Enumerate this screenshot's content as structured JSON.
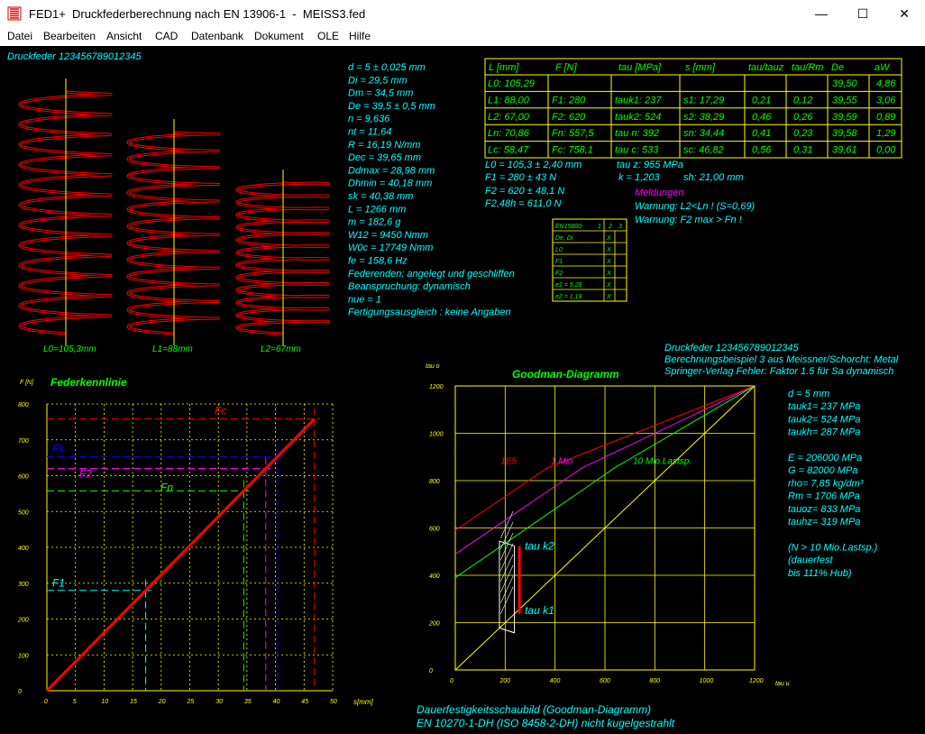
{
  "window": {
    "title": "FED1+  Druckfederberechnung nach EN 13906-1  -  MEISS3.fed",
    "minimize": "—",
    "maximize": "☐",
    "close": "✕"
  },
  "menu": [
    "Datei",
    "Bearbeiten",
    "Ansicht",
    "CAD",
    "Datenbank",
    "Dokument",
    "OLE",
    "Hilfe"
  ],
  "header": {
    "druckfeder": "Druckfeder  123456789012345"
  },
  "spring_labels": [
    "L0=105,3mm",
    "L1=88mm",
    "L2=67mm"
  ],
  "params": [
    "d = 5 ± 0,025 mm",
    "Di = 29,5 mm",
    "Dm = 34,5 mm",
    "De = 39,5 ± 0,5 mm",
    "n = 9,636",
    "nt = 11,64",
    "R = 16,19 N/mm",
    "Dec = 39,65 mm",
    "Ddmax = 28,98 mm",
    "Dhmin = 40,18 mm",
    "sk = 40,38 mm",
    "L = 1266 mm",
    "m = 182,6 g",
    "W12 = 9450 Nmm",
    "W0c = 17749 Nmm",
    "fe = 158,6 Hz",
    "Federenden: angelegt und geschliffen",
    "Beanspruchung: dynamisch",
    "nue = 1",
    "Fertigungsausgleich : keine Angaben"
  ],
  "table": {
    "headers": [
      "L [mm]",
      "F [N]",
      "tau [MPa]",
      "s [mm]",
      "tau/tauz",
      "tau/Rm",
      "De",
      "aW"
    ],
    "rows": [
      [
        "L0: 105,29",
        "",
        "",
        "",
        "",
        "",
        "39,50",
        "4,86"
      ],
      [
        "L1:  88,00",
        "F1: 280",
        "tauk1: 237",
        "s1:  17,29",
        "0,21",
        "0,12",
        "39,55",
        "3,06"
      ],
      [
        "L2:  67,00",
        "F2: 620",
        "tauk2: 524",
        "s2:  38,29",
        "0,46",
        "0,26",
        "39,59",
        "0,89"
      ],
      [
        "Ln:  70,86",
        "Fn: 557,5",
        "tau n: 392",
        "sn:  34,44",
        "0,41",
        "0,23",
        "39,58",
        "1,29"
      ],
      [
        "Lc:  58,47",
        "Fc: 758,1",
        "tau c: 533",
        "sc:  46,82",
        "0,56",
        "0,31",
        "39,61",
        "0,00"
      ]
    ]
  },
  "summary": {
    "left": [
      "L0 = 105,3 ± 2,40 mm",
      "F1 = 280 ± 43 N",
      "F2 = 620 ± 48,1 N",
      "F2,48h = 611,0 N"
    ],
    "tauz": "tau z: 955 MPa",
    "k": "k = 1,203",
    "sh": "sh:  21,00 mm"
  },
  "messages": {
    "title": "Meldungen",
    "lines": [
      "Warnung: L2<Ln ! (S=0,69)",
      "Warnung: F2 max > Fn !"
    ]
  },
  "en_table": {
    "header": [
      "EN15800-",
      "1",
      "2",
      "3"
    ],
    "rows": [
      [
        "De, Di",
        "X"
      ],
      [
        "L0",
        "X"
      ],
      [
        "F1",
        "X"
      ],
      [
        "F2",
        "X"
      ],
      [
        "e1 = 5,28",
        "X"
      ],
      [
        "e2 = 1,19",
        "X"
      ]
    ]
  },
  "chart_data": [
    {
      "type": "line",
      "title": "Federkennlinie",
      "ylabel": "F [N]",
      "xlabel": "s[mm]",
      "xlim": [
        0,
        50
      ],
      "ylim": [
        0,
        800
      ],
      "xticks": [
        "0",
        "5",
        "10",
        "15",
        "20",
        "25",
        "30",
        "35",
        "40",
        "45",
        "50"
      ],
      "yticks": [
        "0",
        "100",
        "200",
        "300",
        "400",
        "500",
        "600",
        "700",
        "800"
      ],
      "grid": true,
      "series": [
        {
          "name": "",
          "x": [
            0,
            46.82
          ],
          "y": [
            0,
            758.1
          ]
        }
      ],
      "markers": [
        {
          "name": "F1",
          "s": 17.29,
          "F": 280,
          "color": "#00FFFF"
        },
        {
          "name": "F2",
          "s": 38.29,
          "F": 620,
          "color": "#FF00FF"
        },
        {
          "name": "Fn",
          "s": 34.44,
          "F": 557.5,
          "color": "#00FF00"
        },
        {
          "name": "Fk",
          "s": 40.38,
          "F": 653,
          "color": "#0000FF"
        },
        {
          "name": "Fc",
          "s": 46.82,
          "F": 758.1,
          "color": "#FF0000"
        }
      ]
    },
    {
      "type": "line",
      "title": "Goodman-Diagramm",
      "ylabel": "tau o",
      "xlabel": "tau u",
      "xlim": [
        0,
        1200
      ],
      "ylim": [
        0,
        1200
      ],
      "xticks": [
        "0",
        "200",
        "400",
        "600",
        "800",
        "1000",
        "1200"
      ],
      "yticks": [
        "0",
        "200",
        "400",
        "600",
        "800",
        "1000",
        "1200"
      ],
      "grid": true,
      "series": [
        {
          "name": "1E5",
          "color": "#FF0000",
          "x": [
            0,
            370,
            1200
          ],
          "y": [
            590,
            855,
            1200
          ]
        },
        {
          "name": "1 Mio",
          "color": "#FF00FF",
          "x": [
            0,
            510,
            1200
          ],
          "y": [
            490,
            855,
            1200
          ]
        },
        {
          "name": "10 Mio.Lastsp.",
          "color": "#00FF00",
          "x": [
            0,
            640,
            1200
          ],
          "y": [
            390,
            855,
            1200
          ]
        },
        {
          "name": "",
          "color": "#FFFF00",
          "x": [
            0,
            1200
          ],
          "y": [
            0,
            1200
          ]
        }
      ],
      "annotations": [
        {
          "text": "tau k2",
          "x": 257,
          "y": 524
        },
        {
          "text": "tau k1",
          "x": 257,
          "y": 237
        }
      ]
    }
  ],
  "goodman_info": {
    "lines": [
      "Druckfeder  123456789012345",
      "Berechnungsbeispiel 3 aus Meissner/Schorcht: Metal",
      "Springer-Verlag    Fehler: Faktor 1.5 für Sa dynamisch"
    ],
    "params": [
      "d  = 5 mm",
      "tauk1=  237 MPa",
      "tauk2=  524 MPa",
      "taukh=  287 MPa",
      "",
      "E = 206000 MPa",
      "G  =  82000 MPa",
      "rho=  7,85 kg/dm³",
      "Rm  =  1706 MPa",
      "tauoz=  833 MPa",
      "tauhz=  319 MPa",
      "",
      "(N > 10 Mio.Lastsp.)",
      "(dauerfest",
      "bis 111% Hub)"
    ]
  },
  "footer": [
    "Dauerfestigkeitsschaubild (Goodman-Diagramm)",
    "EN 10270-1-DH (ISO 8458-2-DH) nicht kugelgestrahlt"
  ],
  "colors": {
    "background": "#000000",
    "grid": "#FFFF00",
    "text_main": "#00FFFF",
    "text_green": "#00FF00",
    "message": "#FF00FF",
    "spring": "#FF0000",
    "axis": "#FFFF00"
  }
}
